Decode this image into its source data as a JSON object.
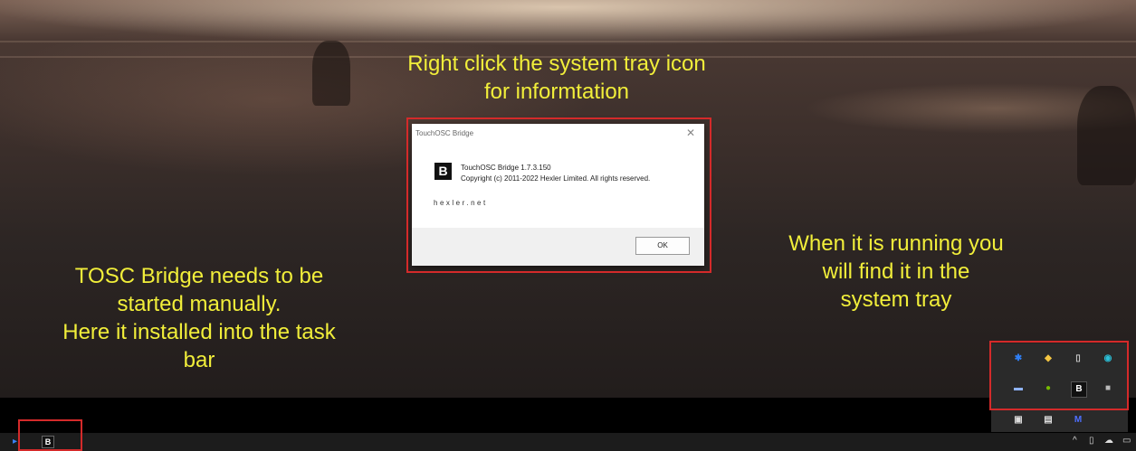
{
  "captions": {
    "top": [
      "Right click the system tray icon",
      "for informtation"
    ],
    "left": [
      "TOSC Bridge needs to be",
      "started manually.",
      "Here it installed into the task",
      "bar"
    ],
    "right": [
      "When it is running you",
      "will find it in the",
      "system tray"
    ]
  },
  "dialog": {
    "title": "TouchOSC Bridge",
    "close": "✕",
    "logo_letter": "B",
    "version_line": "TouchOSC Bridge 1.7.3.150",
    "copyright_line": "Copyright (c) 2011-2022 Hexler Limited. All rights reserved.",
    "link": "hexler.net",
    "ok_label": "OK"
  },
  "tray": {
    "bridge_letter": "B",
    "icons": [
      "bluetooth-icon",
      "shield-icon",
      "usb-drive-icon",
      "refresh-app-icon",
      "chat-icon",
      "nvidia-icon",
      "touchosc-bridge-icon",
      "camera-app-icon",
      "cloud-drive-icon",
      "printer-icon",
      "m-app-icon"
    ]
  },
  "taskbar": {
    "bridge_letter": "B",
    "chevron": "^"
  },
  "colors": {
    "caption": "#f1ee3a",
    "highlight": "#d42a2a"
  }
}
